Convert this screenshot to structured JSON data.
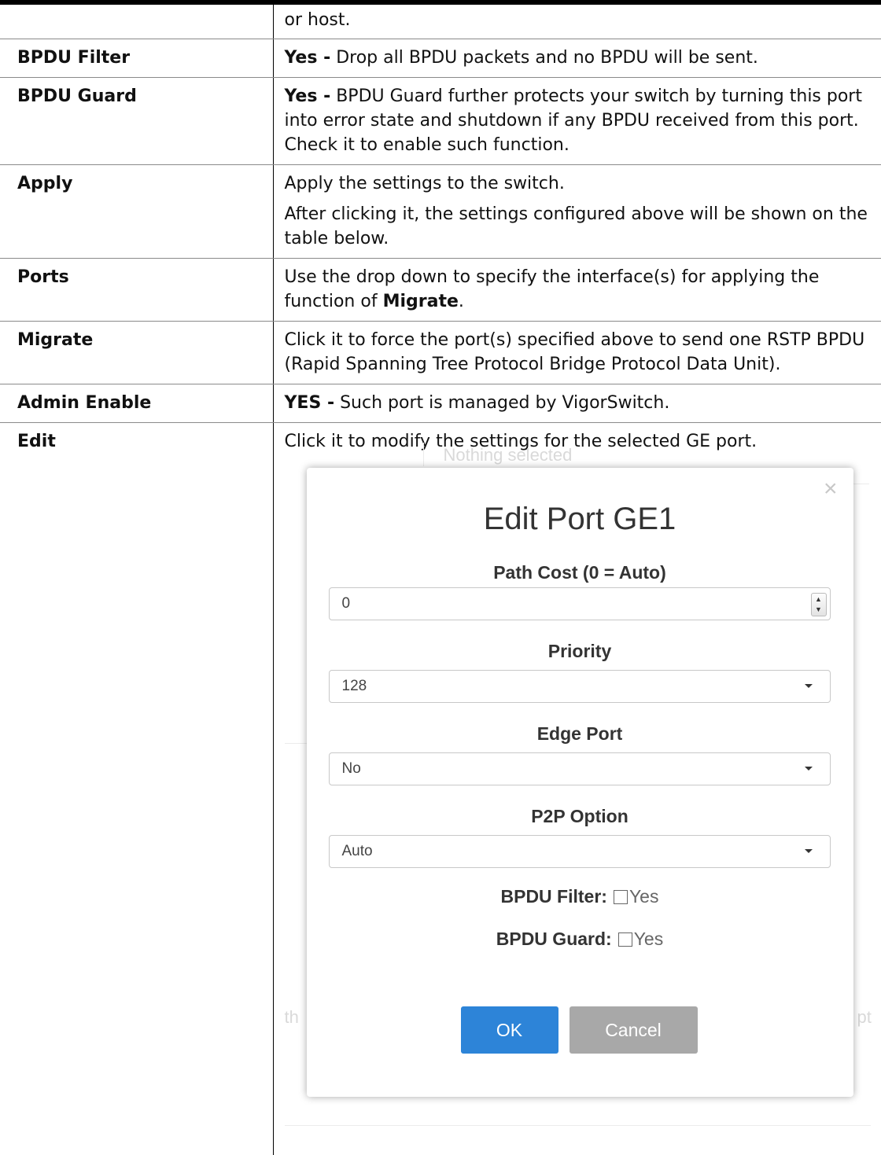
{
  "rows": [
    {
      "term": "",
      "desc": "or host."
    },
    {
      "term": "BPDU Filter",
      "desc_bold": "Yes -",
      "desc_rest": " Drop all BPDU packets and no BPDU will be sent."
    },
    {
      "term": "BPDU Guard",
      "desc_bold": "Yes -",
      "desc_rest": " BPDU Guard further protects your switch by turning this port into error state and shutdown if any BPDU received from this port. Check it to enable such function."
    },
    {
      "term": "Apply",
      "desc": "Apply the settings to the switch.",
      "desc2": "After clicking it, the settings configured above will be shown on the table below."
    },
    {
      "term": "Ports",
      "desc_pre": "Use the drop down to specify the interface(s) for applying the function of ",
      "desc_bold": "Migrate",
      "desc_post": "."
    },
    {
      "term": "Migrate",
      "desc": "Click it to force the port(s) specified above to send one RSTP BPDU (Rapid Spanning Tree Protocol Bridge Protocol Data Unit)."
    },
    {
      "term": "Admin Enable",
      "desc_bold": "YES -",
      "desc_rest": " Such port is managed by VigorSwitch."
    },
    {
      "term": "Edit",
      "desc": "Click it to modify the settings for the selected GE port."
    }
  ],
  "background_fragments": {
    "top": "Nothing selected",
    "left": "th",
    "right": "pt"
  },
  "dialog": {
    "close_glyph": "×",
    "title": "Edit Port GE1",
    "path_cost_label": "Path Cost (0 = Auto)",
    "path_cost_value": "0",
    "priority_label": "Priority",
    "priority_value": "128",
    "edge_port_label": "Edge Port",
    "edge_port_value": "No",
    "p2p_label": "P2P Option",
    "p2p_value": "Auto",
    "bpdu_filter_label": "BPDU Filter:",
    "bpdu_filter_option": "Yes",
    "bpdu_guard_label": "BPDU Guard:",
    "bpdu_guard_option": "Yes",
    "ok_label": "OK",
    "cancel_label": "Cancel"
  },
  "icons": {
    "spinner_up": "▲",
    "spinner_down": "▼"
  }
}
